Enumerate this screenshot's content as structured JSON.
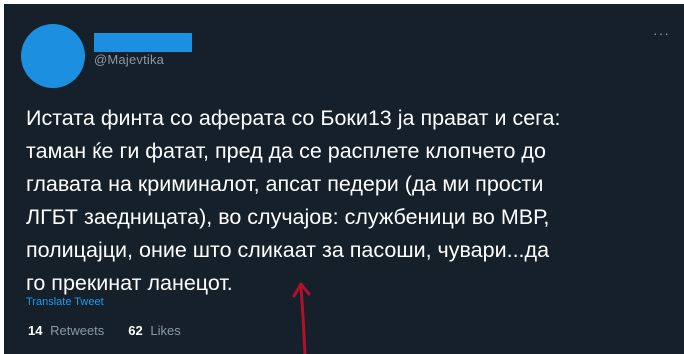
{
  "tweet": {
    "handle": "@Majevtika",
    "text_lines": [
      "Истата финта со аферата со Боки13 ја прават и сега:",
      "таман ќе ги фатат, пред да се расплете клопчето до",
      "главата на криминалот, апсат педери (да ми прости",
      "ЛГБТ заедницата), во случајов: службеници во МВР,",
      "полицајци, оние што сликаат за пасоши, чувари...да",
      "го прекинат ланецот."
    ],
    "translate_label": "Translate Tweet",
    "more_label": "···",
    "retweets": {
      "count": "14",
      "label": "Retweets"
    },
    "likes": {
      "count": "62",
      "label": "Likes"
    }
  },
  "colors": {
    "background": "#15202b",
    "accent": "#1d8fe0",
    "annotation_arrow": "#b3102a"
  },
  "icons": {
    "more": "more-horizontal-icon",
    "annotation": "red-arrow-annotation"
  }
}
